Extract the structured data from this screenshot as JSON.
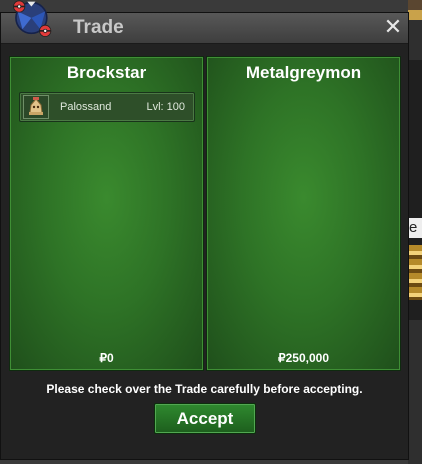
{
  "window": {
    "title": "Trade",
    "close_glyph": "✕"
  },
  "left_panel": {
    "trainer": "Brockstar",
    "money": "₽0",
    "items": [
      {
        "icon": "palossand-sprite-icon",
        "name": "Palossand",
        "level": "Lvl: 100"
      }
    ]
  },
  "right_panel": {
    "trainer": "Metalgreymon",
    "money": "₽250,000",
    "items": []
  },
  "footer": {
    "notice": "Please check over the Trade carefully before accepting.",
    "accept_label": "Accept"
  },
  "background": {
    "visible_text": "e"
  },
  "colors": {
    "panel_green": "#2e7326",
    "accept_green": "#2f8a2f",
    "title_text": "#c8c8c8"
  }
}
